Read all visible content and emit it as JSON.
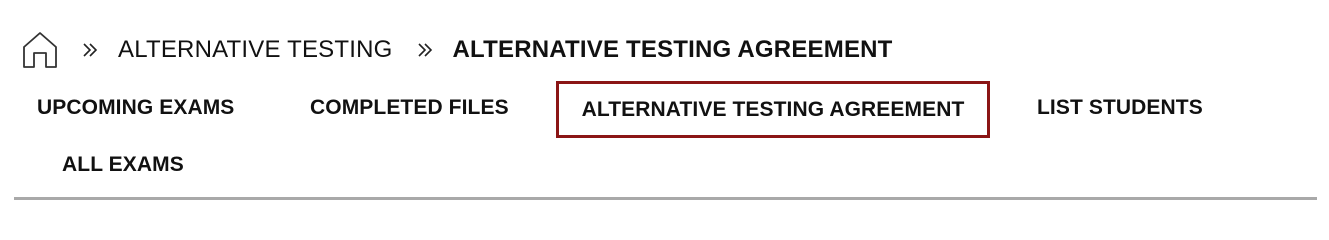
{
  "breadcrumb": {
    "home_icon": "home-icon",
    "separator_icon": "double-chevron-right-icon",
    "items": [
      {
        "label": "ALTERNATIVE TESTING"
      },
      {
        "label": "ALTERNATIVE TESTING AGREEMENT"
      }
    ]
  },
  "tabs": [
    {
      "label": "UPCOMING EXAMS",
      "active": false
    },
    {
      "label": "COMPLETED FILES",
      "active": false
    },
    {
      "label": "ALTERNATIVE TESTING AGREEMENT",
      "active": true
    },
    {
      "label": "LIST STUDENTS",
      "active": false
    },
    {
      "label": "ALL EXAMS",
      "active": false
    }
  ],
  "colors": {
    "active_tab_border": "#8b1515",
    "divider": "#a9a9a9",
    "text": "#111111"
  }
}
